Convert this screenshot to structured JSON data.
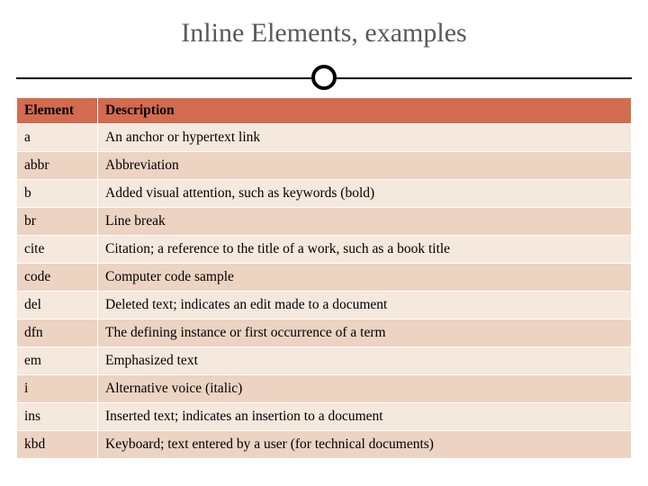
{
  "title": "Inline Elements, examples",
  "headers": {
    "element": "Element",
    "description": "Description"
  },
  "rows": [
    {
      "el": "a",
      "desc": "An anchor or hypertext link"
    },
    {
      "el": "abbr",
      "desc": "Abbreviation"
    },
    {
      "el": "b",
      "desc": "Added visual attention, such as keywords (bold)"
    },
    {
      "el": "br",
      "desc": "Line break"
    },
    {
      "el": "cite",
      "desc": "Citation; a reference to the title of a work, such as a book title"
    },
    {
      "el": "code",
      "desc": "Computer code sample"
    },
    {
      "el": "del",
      "desc": "Deleted text; indicates an edit made to a document"
    },
    {
      "el": "dfn",
      "desc": "The defining instance or first occurrence of a term"
    },
    {
      "el": "em",
      "desc": "Emphasized text"
    },
    {
      "el": "i",
      "desc": "Alternative voice (italic)"
    },
    {
      "el": "ins",
      "desc": "Inserted text; indicates an insertion to a document"
    },
    {
      "el": "kbd",
      "desc": "Keyboard; text entered by a user (for technical documents)"
    }
  ]
}
